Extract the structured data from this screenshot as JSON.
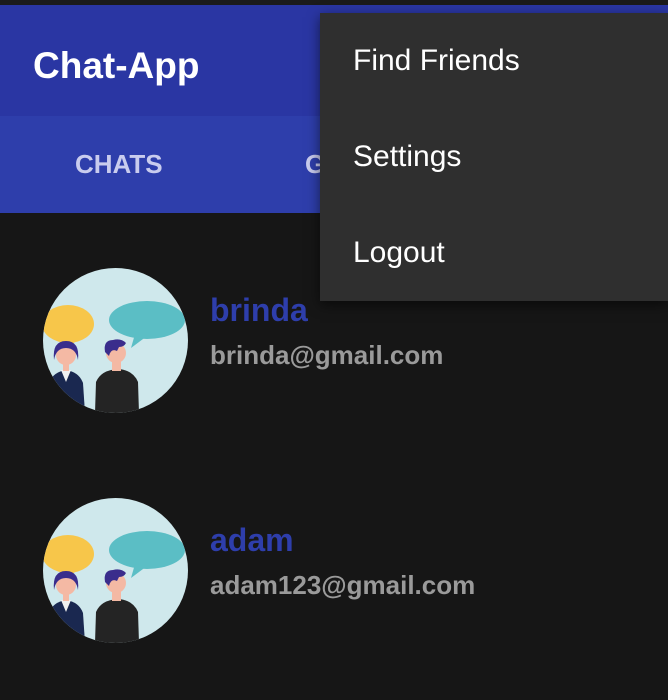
{
  "app": {
    "title": "Chat-App"
  },
  "tabs": [
    {
      "label": "CHATS"
    },
    {
      "label": "G"
    }
  ],
  "contacts": [
    {
      "name": "brinda",
      "email": "brinda@gmail.com"
    },
    {
      "name": "adam",
      "email": "adam123@gmail.com"
    }
  ],
  "menu": {
    "items": [
      {
        "label": "Find Friends"
      },
      {
        "label": "Settings"
      },
      {
        "label": "Logout"
      }
    ]
  },
  "colors": {
    "appbar": "#2a36a3",
    "tabbar": "#2e3eab",
    "background": "#161616",
    "menu": "#2f2f2f",
    "name_text": "#2e3eab",
    "email_text": "#9a9a9a"
  },
  "icons": {
    "avatar": "two-people-chatting-avatar"
  }
}
